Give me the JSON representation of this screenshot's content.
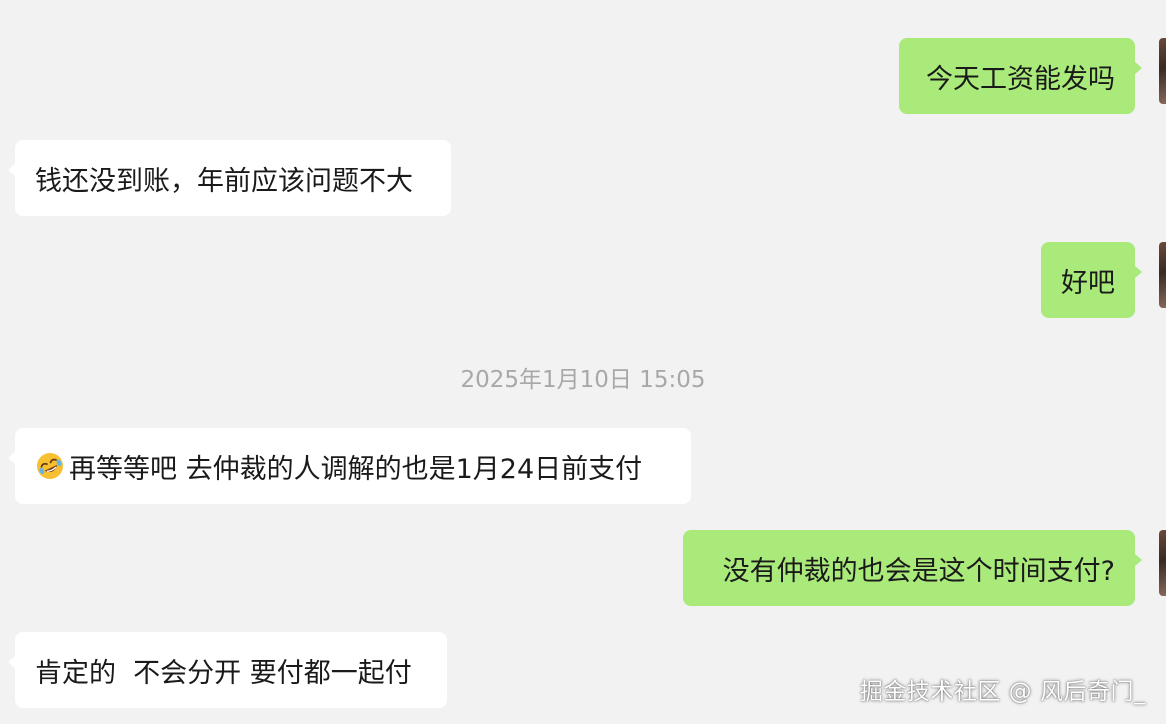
{
  "chat": {
    "messages": [
      {
        "side": "out",
        "text": "今天工资能发吗"
      },
      {
        "side": "in",
        "text": "钱还没到账，年前应该问题不大"
      },
      {
        "side": "out",
        "text": "好吧"
      },
      {
        "side": "in",
        "emoji": "rolling-on-floor-laughing-emoji",
        "text": "再等等吧 去仲裁的人调解的也是1月24日前支付"
      },
      {
        "side": "out",
        "text": "没有仲裁的也会是这个时间支付?"
      },
      {
        "side": "in",
        "text": "肯定的  不会分开 要付都一起付"
      }
    ],
    "timestamp": "2025年1月10日 15:05"
  },
  "watermark": "掘金技术社区 @ 风后奇门_",
  "colors": {
    "background": "#f2f2f2",
    "incoming_bubble": "#ffffff",
    "outgoing_bubble": "#a9ea7a",
    "timestamp_text": "#a8a8a8"
  }
}
